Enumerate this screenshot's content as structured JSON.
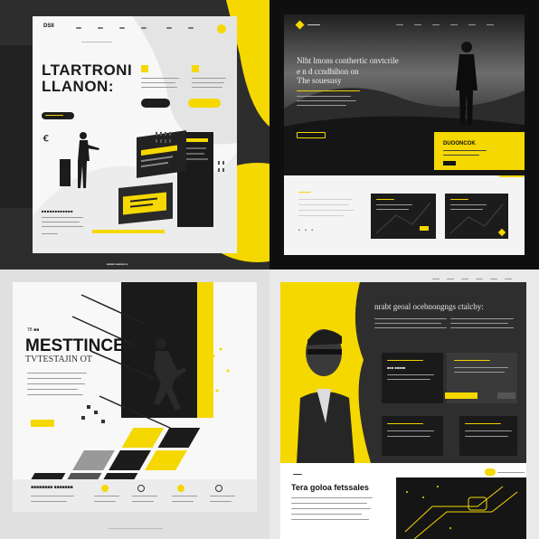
{
  "mockup1": {
    "logo": "DSII",
    "headline_1": "LTARTRONI",
    "headline_2": "LLANON:",
    "mark": "Ꞓ",
    "section_label": "■■■■■■■■■■■■"
  },
  "mockup2": {
    "headline_1": "Nlht lmons  conthertic  onvtcrile",
    "headline_2": "e n d ccndhihon on",
    "headline_3": "'I'he souesusy",
    "card_title": "DUOONCOK"
  },
  "mockup3": {
    "tag": "'IB  ■■",
    "headline_1": "MESTTINCE",
    "headline_2": "TVTESTAJIN OT",
    "bottom_label": "■■■■■■■■ ■■■■■■■"
  },
  "mockup4": {
    "headline": "nrabt geoal ocebnongngs ctalcby:",
    "footer_headline": "Tera goloa fetssales"
  },
  "footer_caption": "■■■■■ ■■■■■■ ■"
}
